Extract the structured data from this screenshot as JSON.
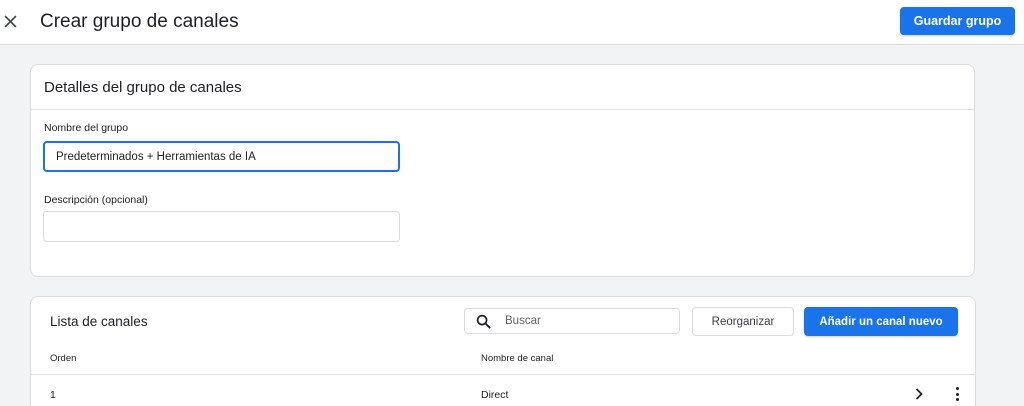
{
  "header": {
    "title": "Crear grupo de canales",
    "save_label": "Guardar grupo"
  },
  "details": {
    "title": "Detalles del grupo de canales",
    "name_label": "Nombre del grupo",
    "name_value": "Predeterminados + Herramientas de IA",
    "description_label": "Descripción (opcional)",
    "description_value": ""
  },
  "channels": {
    "title": "Lista de canales",
    "search_placeholder": "Buscar",
    "reorganize_label": "Reorganizar",
    "add_label": "Añadir un canal nuevo",
    "columns": [
      "Orden",
      "Nombre de canal"
    ],
    "rows": [
      {
        "order": "1",
        "name": "Direct"
      }
    ]
  },
  "colors": {
    "accent": "#1a73e8",
    "background": "#f1f3f4",
    "border": "#dadce0"
  },
  "icons": [
    "close-icon",
    "search-icon",
    "chevron-right-icon",
    "more-vert-icon"
  ]
}
